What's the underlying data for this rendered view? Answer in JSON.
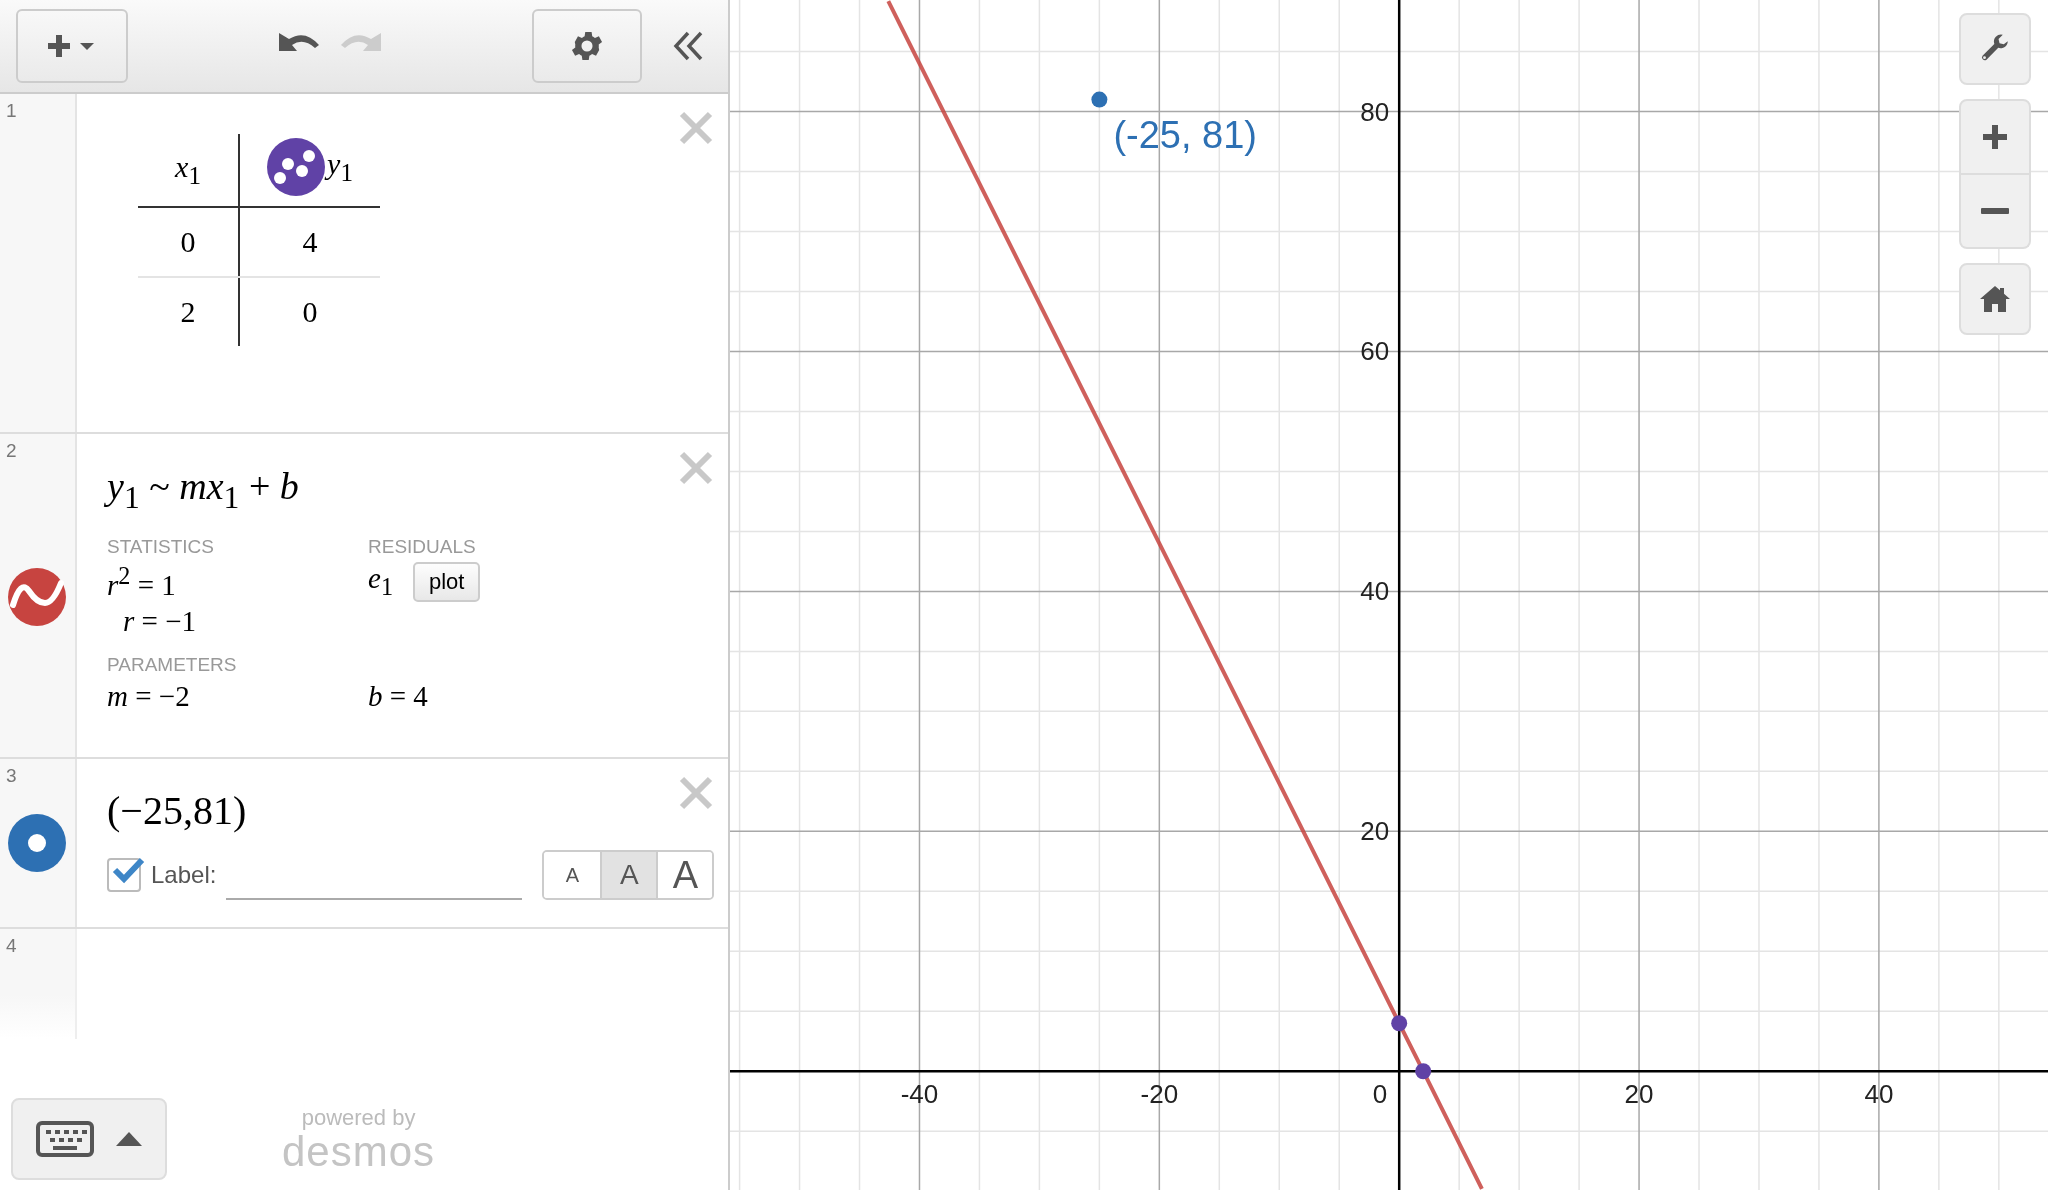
{
  "toolbar": {
    "undo": {
      "disabled": false
    },
    "redo": {
      "disabled": true
    }
  },
  "expressions": [
    {
      "kind": "table",
      "number": "1",
      "columns": [
        {
          "header": "*x*$_{1}$"
        },
        {
          "header": "*y*$_{1}$",
          "color": "#6042a6"
        }
      ],
      "rows": [
        [
          "0",
          "4"
        ],
        [
          "2",
          "0"
        ]
      ]
    },
    {
      "kind": "regression",
      "number": "2",
      "color": "#c74440",
      "statistics_heading": "STATISTICS",
      "statistics": [
        "*r*$^{2}$ = 1",
        "*r* = −1"
      ],
      "residuals_heading": "RESIDUALS",
      "residual_variable": "*e*$_{1}$",
      "plot_button": "plot",
      "parameters_heading": "PARAMETERS",
      "parameters": [
        "*m* = −2",
        "*b* = 4"
      ]
    },
    {
      "kind": "point",
      "number": "3",
      "color": "#2d70b3",
      "formula": "(−25,81)",
      "label_checkbox": {
        "checked": true,
        "label": "Label:"
      },
      "size_buttons": [
        {
          "label": "A",
          "selected": false
        },
        {
          "label": "A",
          "selected": true
        },
        {
          "label": "A",
          "selected": false
        }
      ]
    },
    {
      "kind": "empty",
      "number": "4"
    }
  ],
  "footer": {
    "powered_by": "powered by",
    "logo": "desmos"
  },
  "graph": {
    "origin_label": "0",
    "chart_data": {
      "type": "line",
      "xlim": [
        -55.8,
        54.1
      ],
      "ylim": [
        -9.9,
        89.3
      ],
      "xticks": [
        -40,
        -20,
        20,
        40
      ],
      "yticks": [
        20,
        40,
        60,
        80
      ],
      "grid": true,
      "x": [
        -42.6,
        0,
        2,
        6.9
      ],
      "series": [
        {
          "name": "*y*$_{1}$ ~ *mx*$_{1}$ + *b*",
          "color": "#c74440",
          "values": [
            89.2,
            4,
            0,
            -9.8
          ]
        }
      ],
      "annotations": [
        {
          "x": -25,
          "y": 81,
          "text": "(-25, 81)"
        }
      ]
    }
  }
}
